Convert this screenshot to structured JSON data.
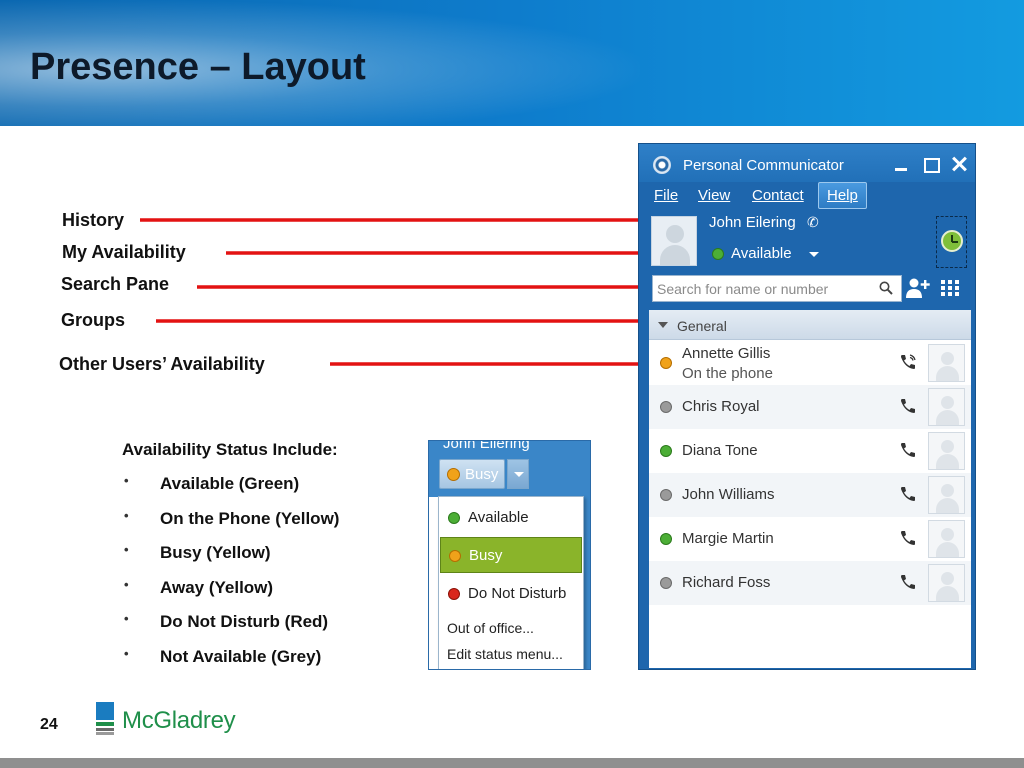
{
  "slide": {
    "title": "Presence – Layout",
    "page_number": "24",
    "logo_text": "McGladrey",
    "colors": {
      "header_blue": "#0e7ccc",
      "arrow_red": "#e31212",
      "logo_green": "#1f8f4a"
    }
  },
  "callouts": [
    {
      "label": "History",
      "icon": "arrow-right-icon"
    },
    {
      "label": "My Availability",
      "icon": "arrow-right-icon"
    },
    {
      "label": "Search Pane",
      "icon": "arrow-right-icon"
    },
    {
      "label": "Groups",
      "icon": "arrow-right-icon"
    },
    {
      "label": "Other Users’ Availability",
      "icon": "arrow-right-icon"
    }
  ],
  "status_info": {
    "heading": "Availability Status Include:",
    "items": [
      "Available (Green)",
      "On the Phone (Yellow)",
      "Busy (Yellow)",
      "Away (Yellow)",
      "Do Not Disturb (Red)",
      "Not Available (Grey)"
    ]
  },
  "dropdown_inset": {
    "user_name": "John Eilering",
    "current_status": "Busy",
    "menu": {
      "items": [
        {
          "label": "Available",
          "color": "#4cae36"
        },
        {
          "label": "Busy",
          "color": "#f0a21a",
          "selected": true
        },
        {
          "label": "Do Not Disturb",
          "color": "#d9261c"
        }
      ],
      "extra": [
        "Out of office...",
        "Edit status menu..."
      ]
    }
  },
  "communicator": {
    "title": "Personal Communicator",
    "menus": [
      "File",
      "View",
      "Contact",
      "Help"
    ],
    "me": {
      "name": "John Eilering",
      "status": "Available",
      "status_color": "#4cae36"
    },
    "search_placeholder": "Search for name or number",
    "group": "General",
    "contacts": [
      {
        "name": "Annette Gillis",
        "status_text": "On the phone",
        "status_color": "#f0a21a"
      },
      {
        "name": "Chris Royal",
        "status_color": "#9a9a9a"
      },
      {
        "name": "Diana Tone",
        "status_color": "#4cae36"
      },
      {
        "name": "John Williams",
        "status_color": "#9a9a9a"
      },
      {
        "name": "Margie Martin",
        "status_color": "#4cae36"
      },
      {
        "name": "Richard Foss",
        "status_color": "#9a9a9a"
      }
    ]
  }
}
